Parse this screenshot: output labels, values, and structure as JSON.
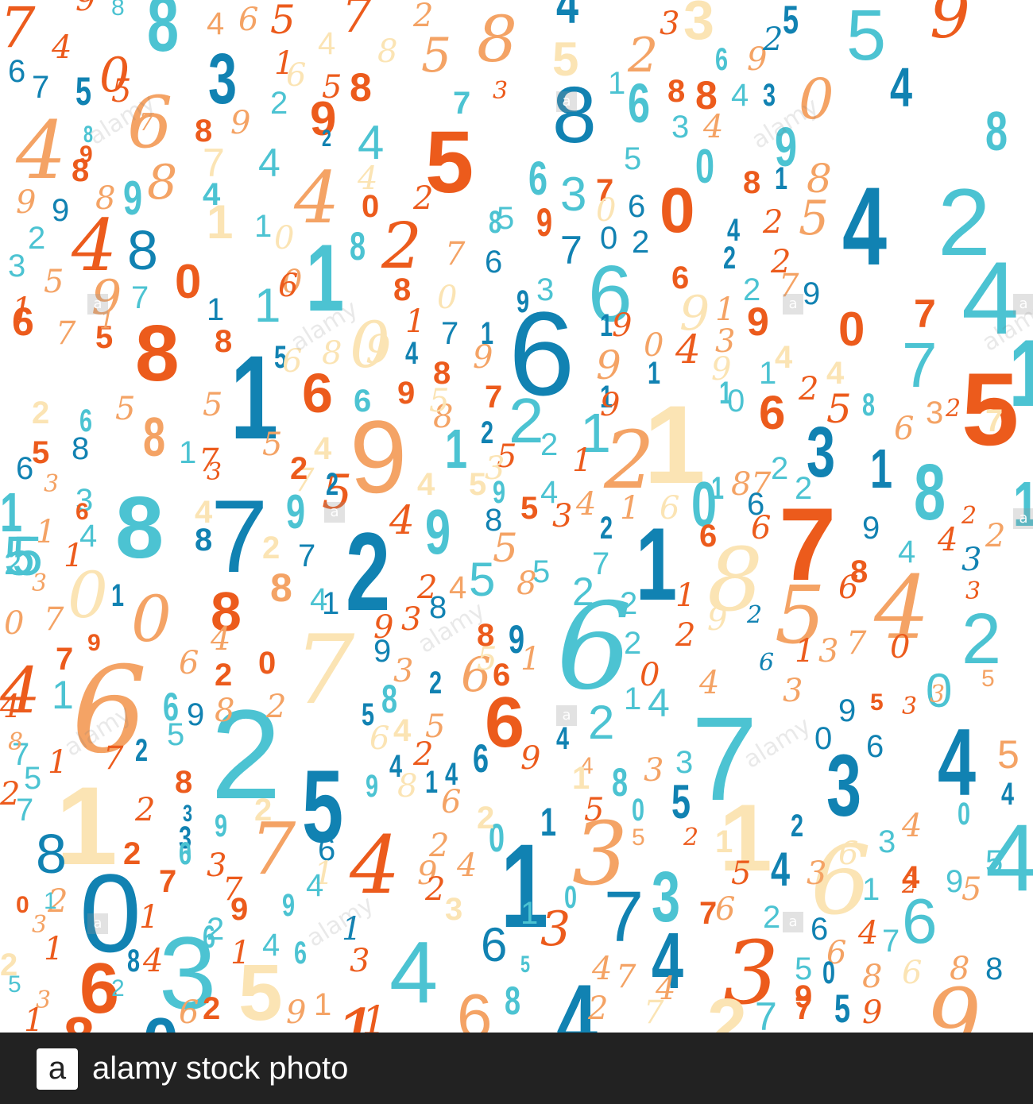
{
  "palette": {
    "dark_blue": "#1182b2",
    "light_blue": "#4cc3d2",
    "dark_orange": "#ec5b1c",
    "light_orange": "#f4a365",
    "pale_yellow": "#fbe4b4"
  },
  "pattern": {
    "description_glyphs": "repeating colorful digits 0-9 in sans, bold, condensed and script styles"
  },
  "watermark": {
    "word": "alamy",
    "badge_letter": "a"
  },
  "footer": {
    "logo_letter": "a",
    "text": "alamy stock photo",
    "background": "#222222"
  }
}
